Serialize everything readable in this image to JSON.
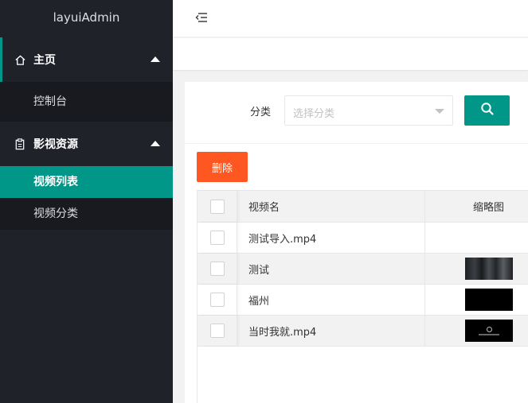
{
  "sidebar": {
    "logo": "layuiAdmin",
    "groups": [
      {
        "label": "主页",
        "icon": "home-icon",
        "items": [
          {
            "label": "控制台"
          }
        ]
      },
      {
        "label": "影视资源",
        "icon": "clipboard-icon",
        "items": [
          {
            "label": "视频列表",
            "active": true
          },
          {
            "label": "视频分类"
          }
        ]
      }
    ]
  },
  "header": {
    "menu_icon": "menu-fold-icon"
  },
  "filter": {
    "label": "分类",
    "select_placeholder": "选择分类",
    "search_icon": "search-icon"
  },
  "toolbar": {
    "delete_label": "删除"
  },
  "table": {
    "columns": [
      "视频名",
      "缩略图"
    ],
    "rows": [
      {
        "name": "测试导入.mp4",
        "thumb": "none"
      },
      {
        "name": "测试",
        "thumb": "dark-scene"
      },
      {
        "name": "福州",
        "thumb": "black"
      },
      {
        "name": "当时我就.mp4",
        "thumb": "black-logo"
      }
    ]
  },
  "colors": {
    "accent": "#009688",
    "danger": "#ff5722",
    "sidebar": "#20222a"
  }
}
